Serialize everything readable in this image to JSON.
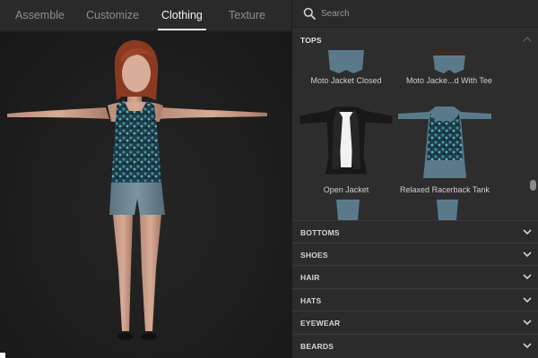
{
  "tabs": [
    {
      "label": "Assemble"
    },
    {
      "label": "Customize"
    },
    {
      "label": "Clothing"
    },
    {
      "label": "Texture"
    }
  ],
  "active_tab": "Clothing",
  "search": {
    "placeholder": "Search",
    "value": ""
  },
  "tops": {
    "header": "TOPS",
    "items": [
      {
        "label": "Moto Jacket Closed"
      },
      {
        "label": "Moto Jacke...d With Tee"
      },
      {
        "label": "Open Jacket"
      },
      {
        "label": "Relaxed Racerback Tank"
      }
    ]
  },
  "categories": [
    {
      "label": "BOTTOMS"
    },
    {
      "label": "SHOES"
    },
    {
      "label": "HAIR"
    },
    {
      "label": "HATS"
    },
    {
      "label": "EYEWEAR"
    },
    {
      "label": "BEARDS"
    }
  ],
  "colors": {
    "background": "#1e1e1e",
    "panel": "#2b2b2b",
    "mannequin": "#5a7a8c",
    "accent_text": "#f2f2f2"
  },
  "icons": {
    "search": "search-icon",
    "chevron": "chevron-down-icon"
  }
}
